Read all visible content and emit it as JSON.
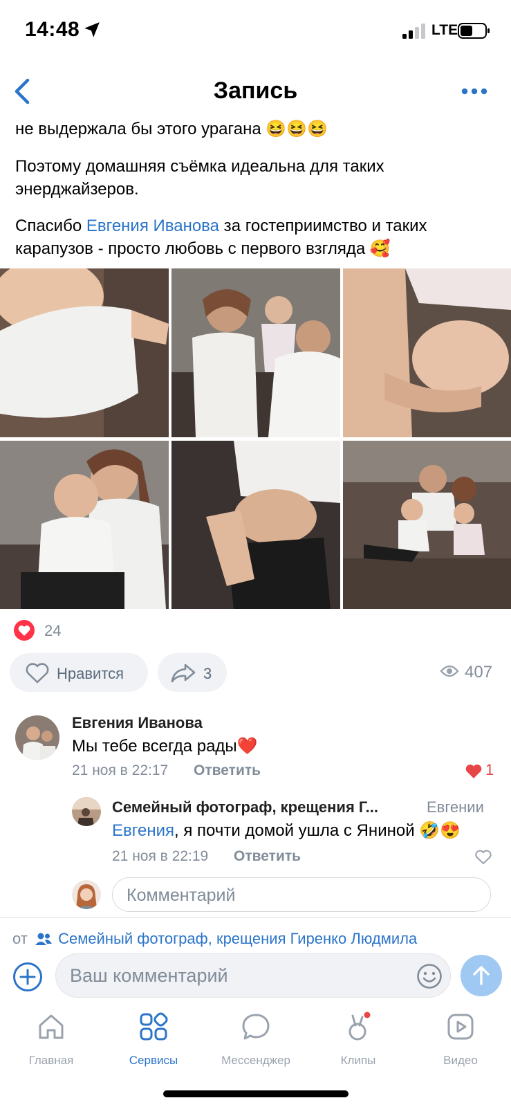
{
  "status_bar": {
    "time": "14:48",
    "network": "LTE"
  },
  "header": {
    "title": "Запись"
  },
  "post": {
    "line1": "не выдержала бы этого урагана 😆😆😆",
    "para2": "Поэтому домашняя съёмка идеальна для таких энерджайзеров.",
    "para3_before": "Спасибо ",
    "para3_link": "Евгения Иванова",
    "para3_after": " за гостеприимство и таких карапузов - просто любовь с первого взгляда 🥰"
  },
  "reactions": {
    "likes_count": "24",
    "like_label": "Нравится",
    "share_count": "3",
    "views": "407"
  },
  "comments": [
    {
      "author": "Евгения Иванова",
      "text": "Мы тебе всегда рады❤️",
      "date": "21 ноя в 22:17",
      "reply_label": "Ответить",
      "likes": "1"
    },
    {
      "author": "Семейный фотограф, крещения Г...",
      "reply_to": "Евгении",
      "mention": "Евгения",
      "text": ", я почти домой ушла с Яниной 🤣😍",
      "date": "21 ноя в 22:19",
      "reply_label": "Ответить"
    }
  ],
  "reply_input": {
    "placeholder": "Комментарий"
  },
  "composer": {
    "from_label": "от",
    "from_name": "Семейный фотограф, крещения Гиренко Людмила",
    "placeholder": "Ваш комментарий"
  },
  "tabbar": [
    {
      "label": "Главная",
      "icon": "home-icon",
      "active": false
    },
    {
      "label": "Сервисы",
      "icon": "services-icon",
      "active": true
    },
    {
      "label": "Мессенджер",
      "icon": "messenger-icon",
      "active": false
    },
    {
      "label": "Клипы",
      "icon": "clips-icon",
      "active": false
    },
    {
      "label": "Видео",
      "icon": "video-icon",
      "active": false
    }
  ],
  "colors": {
    "accent": "#2a74c9",
    "like_red": "#e64646",
    "secondary": "#818c99"
  }
}
